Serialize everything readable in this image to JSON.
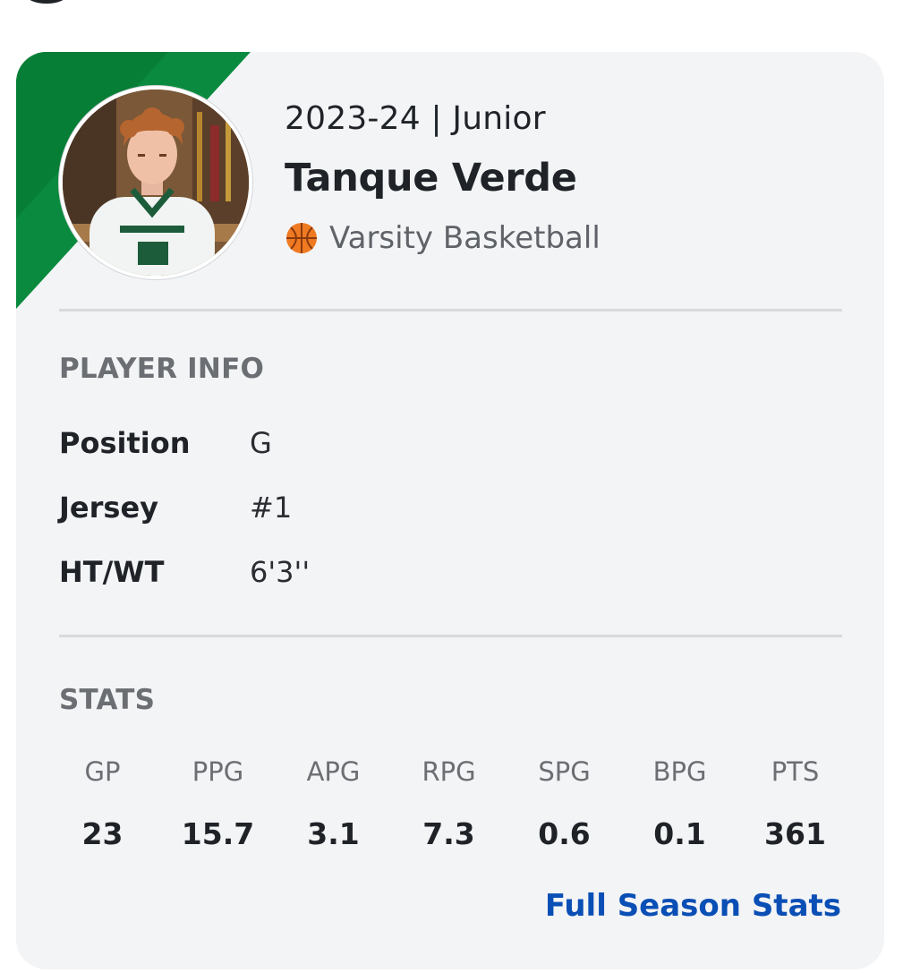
{
  "colors": {
    "team_green": "#0a8a3e",
    "team_green_dark": "#06602b",
    "card_bg": "#f3f4f6",
    "link_blue": "#0a4fb5"
  },
  "player": {
    "avatar_icon": "player-photo",
    "season_line": "2023-24 | Junior",
    "school": "Tanque Verde",
    "sport_icon": "basketball-icon",
    "sport": "Varsity Basketball"
  },
  "player_info": {
    "title": "PLAYER INFO",
    "rows": [
      {
        "label": "Position",
        "value": "G"
      },
      {
        "label": "Jersey",
        "value": "#1"
      },
      {
        "label": "HT/WT",
        "value": "6'3''"
      }
    ]
  },
  "stats": {
    "title": "STATS",
    "columns": [
      {
        "head": "GP",
        "value": "23"
      },
      {
        "head": "PPG",
        "value": "15.7"
      },
      {
        "head": "APG",
        "value": "3.1"
      },
      {
        "head": "RPG",
        "value": "7.3"
      },
      {
        "head": "SPG",
        "value": "0.6"
      },
      {
        "head": "BPG",
        "value": "0.1"
      },
      {
        "head": "PTS",
        "value": "361"
      }
    ],
    "link_label": "Full Season Stats"
  }
}
